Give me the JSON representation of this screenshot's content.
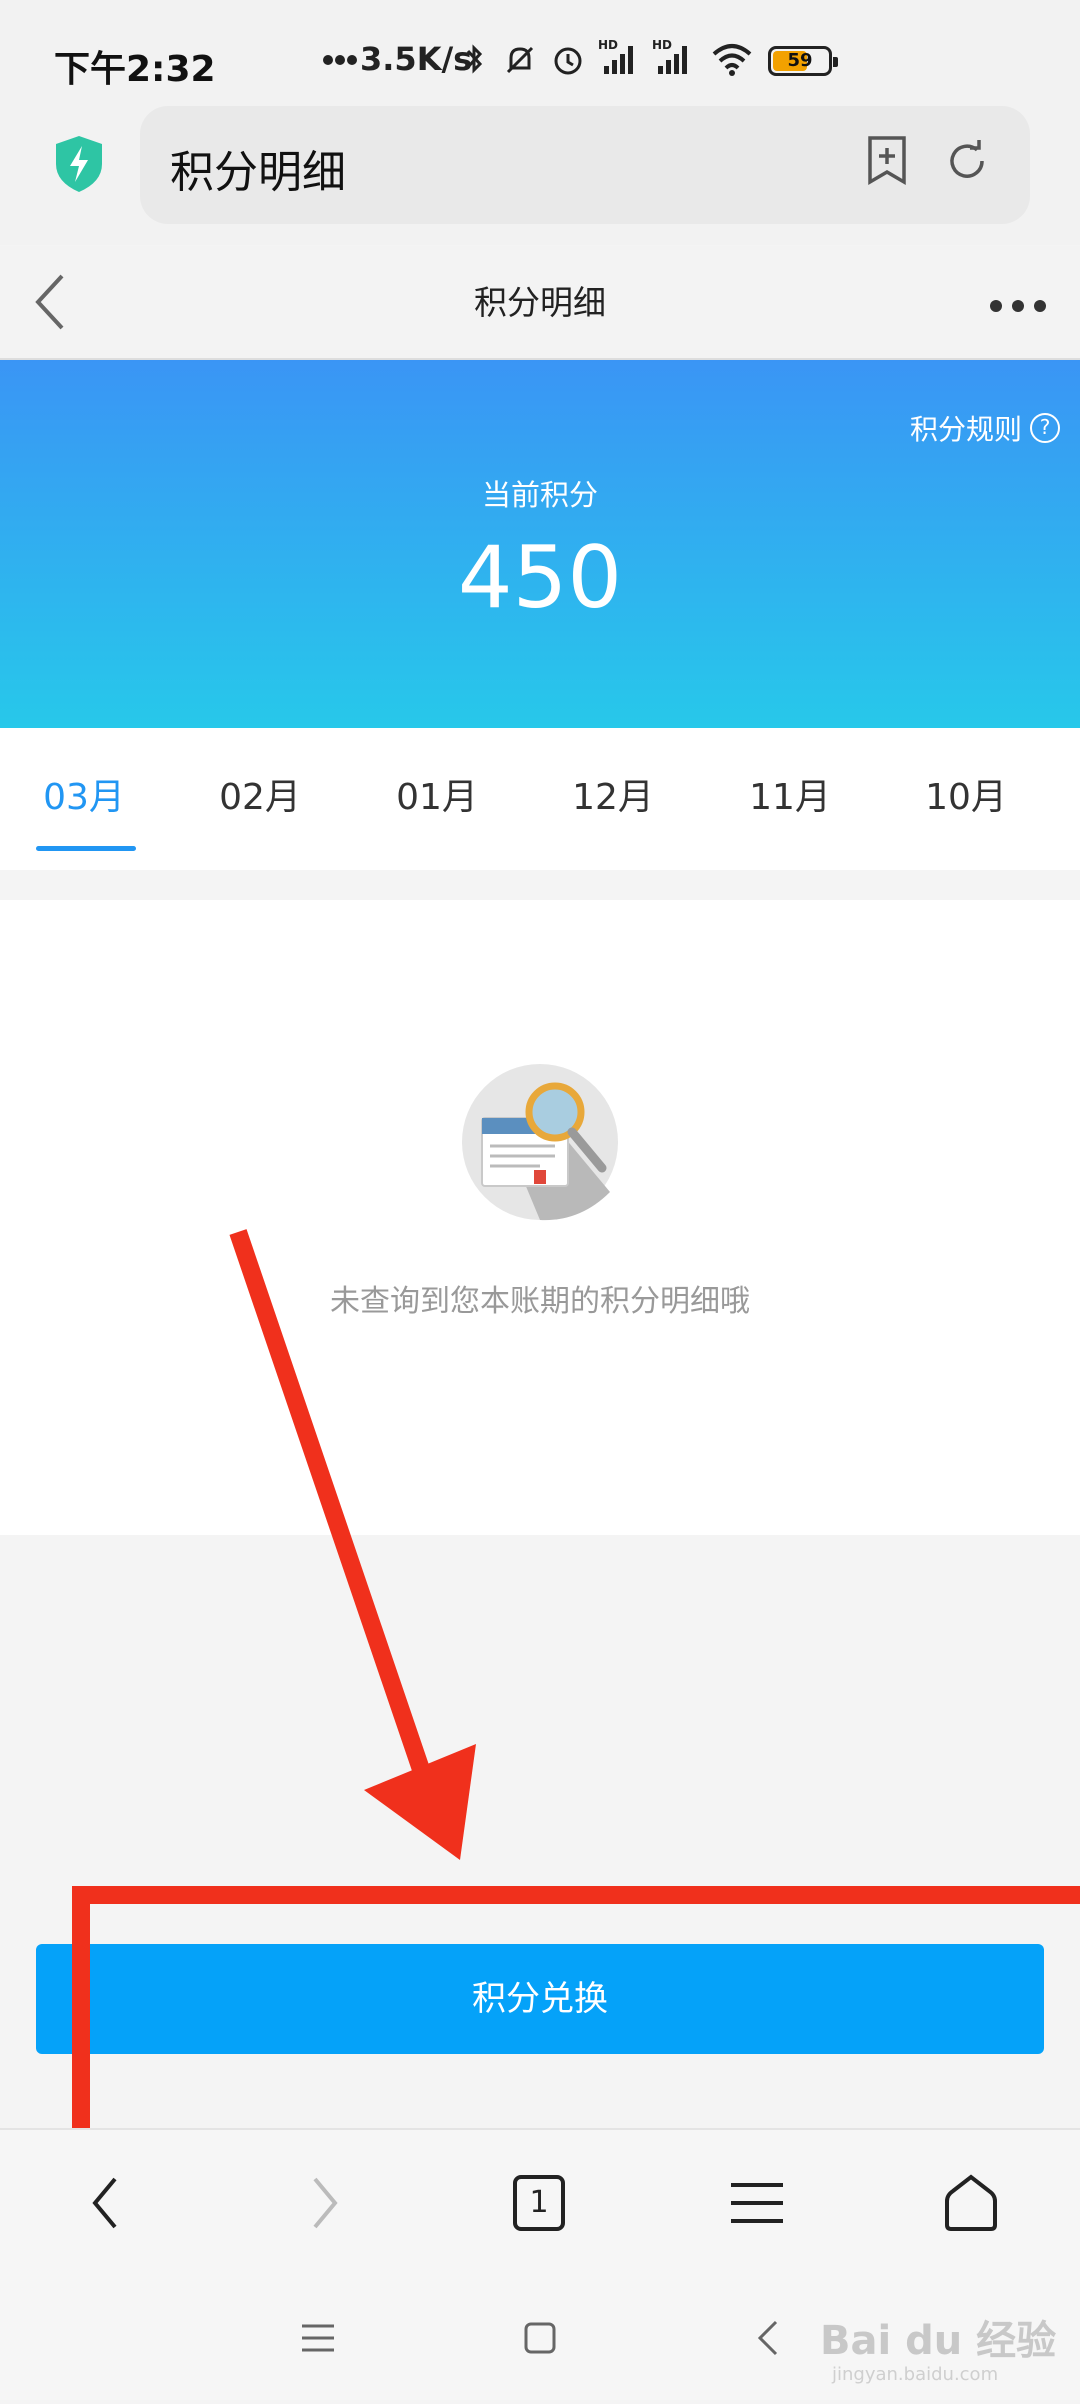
{
  "status_bar": {
    "time": "下午2:32",
    "network_speed": "3.5K/s",
    "battery_level": "59",
    "signal_label_1": "HD",
    "signal_label_2": "HD"
  },
  "browser": {
    "address_text": "积分明细"
  },
  "page": {
    "title": "积分明细"
  },
  "banner": {
    "rules_label": "积分规则",
    "current_label": "当前积分",
    "points": "450"
  },
  "tabs": [
    {
      "label": "03月",
      "active": true
    },
    {
      "label": "02月",
      "active": false
    },
    {
      "label": "01月",
      "active": false
    },
    {
      "label": "12月",
      "active": false
    },
    {
      "label": "11月",
      "active": false
    },
    {
      "label": "10月",
      "active": false
    }
  ],
  "empty_state": {
    "message": "未查询到您本账期的积分明细哦"
  },
  "actions": {
    "exchange_label": "积分兑换"
  },
  "bottom_nav": {
    "tab_count": "1"
  },
  "watermark": {
    "brand": "Bai du 经验",
    "url": "jingyan.baidu.com"
  },
  "colors": {
    "accent": "#2196f3",
    "button": "#05a2f9",
    "annotation": "#f0301c"
  }
}
